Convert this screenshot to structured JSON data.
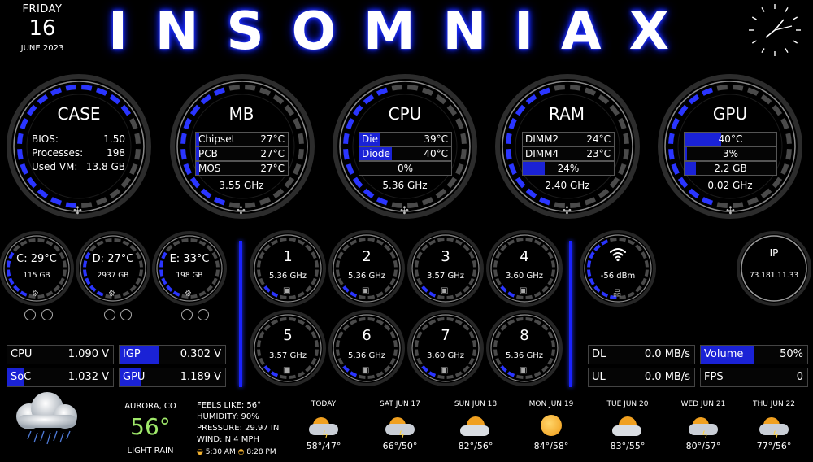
{
  "date": {
    "weekday": "FRIDAY",
    "day": "16",
    "month_year": "JUNE 2023"
  },
  "title": "INSOMNIAX",
  "colors": {
    "accent": "#1a22d6",
    "glow": "#2233ff",
    "temp_green": "#9fe86a"
  },
  "case": {
    "title": "CASE",
    "rows": [
      {
        "label": "BIOS:",
        "value": "1.50"
      },
      {
        "label": "Processes:",
        "value": "198"
      },
      {
        "label": "Used VM:",
        "value": "13.8 GB"
      }
    ],
    "fan_icon": "fan-icon"
  },
  "mb": {
    "title": "MB",
    "rows": [
      {
        "label": "Chipset",
        "value": "27°C"
      },
      {
        "label": "PCB",
        "value": "27°C"
      },
      {
        "label": "MOS",
        "value": "27°C"
      }
    ],
    "freq": "3.55 GHz"
  },
  "cpu": {
    "title": "CPU",
    "rows": [
      {
        "label": "Die",
        "value": "39°C"
      },
      {
        "label": "Diode",
        "value": "40°C"
      }
    ],
    "load": "0%",
    "load_fraction": 0.0,
    "freq": "5.36 GHz"
  },
  "ram": {
    "title": "RAM",
    "rows": [
      {
        "label": "DIMM2",
        "value": "24°C"
      },
      {
        "label": "DIMM4",
        "value": "23°C"
      }
    ],
    "usage": "24%",
    "usage_fraction": 0.24,
    "freq": "2.40 GHz"
  },
  "gpu": {
    "title": "GPU",
    "temp": "40°C",
    "temp_fraction": 0.4,
    "load": "3%",
    "load_fraction": 0.03,
    "mem": "2.2 GB",
    "mem_fraction": 0.12,
    "freq": "0.02 GHz"
  },
  "drives": [
    {
      "label": "C:",
      "temp": "29°C",
      "size": "115 GB"
    },
    {
      "label": "D:",
      "temp": "27°C",
      "size": "2937 GB"
    },
    {
      "label": "E:",
      "temp": "33°C",
      "size": "198 GB"
    }
  ],
  "cores": [
    {
      "num": "1",
      "freq": "5.36 GHz"
    },
    {
      "num": "2",
      "freq": "5.36 GHz"
    },
    {
      "num": "3",
      "freq": "3.57 GHz"
    },
    {
      "num": "4",
      "freq": "3.60 GHz"
    },
    {
      "num": "5",
      "freq": "3.57 GHz"
    },
    {
      "num": "6",
      "freq": "5.36 GHz"
    },
    {
      "num": "7",
      "freq": "3.60 GHz"
    },
    {
      "num": "8",
      "freq": "5.36 GHz"
    }
  ],
  "wifi": {
    "signal": "-56 dBm",
    "icon": "wifi-icon"
  },
  "ip": {
    "label": "IP",
    "value": "73.181.11.33"
  },
  "voltages": [
    {
      "label": "CPU",
      "value": "1.090 V",
      "fraction": 0.0
    },
    {
      "label": "IGP",
      "value": "0.302 V",
      "fraction": 0.38
    },
    {
      "label": "SoC",
      "value": "1.032 V",
      "fraction": 0.16
    },
    {
      "label": "GPU",
      "value": "1.189 V",
      "fraction": 0.21
    }
  ],
  "network": [
    {
      "label": "DL",
      "value": "0.0 MB/s"
    },
    {
      "label": "UL",
      "value": "0.0 MB/s"
    }
  ],
  "volume": {
    "label": "Volume",
    "value": "50%",
    "fraction": 0.5
  },
  "fps": {
    "label": "FPS",
    "value": "0"
  },
  "weather": {
    "location": "AURORA, CO",
    "temp": "56°",
    "condition": "LIGHT RAIN",
    "feels_like": "FEELS LIKE: 56°",
    "humidity": "HUMIDITY: 90%",
    "pressure": "PRESSURE: 29.97 IN",
    "wind": "WIND: N 4 MPH",
    "sunrise": "5:30 AM",
    "sunset": "8:28 PM"
  },
  "forecast": [
    {
      "day": "TODAY",
      "temps": "58°/47°",
      "icon": "storm-icon"
    },
    {
      "day": "SAT JUN 17",
      "temps": "66°/50°",
      "icon": "storm-icon"
    },
    {
      "day": "SUN JUN 18",
      "temps": "82°/56°",
      "icon": "partly-cloudy-icon"
    },
    {
      "day": "MON JUN 19",
      "temps": "84°/58°",
      "icon": "sun-icon"
    },
    {
      "day": "TUE JUN 20",
      "temps": "83°/55°",
      "icon": "partly-cloudy-icon"
    },
    {
      "day": "WED JUN 21",
      "temps": "80°/57°",
      "icon": "storm-icon"
    },
    {
      "day": "THU JUN 22",
      "temps": "77°/56°",
      "icon": "storm-icon"
    }
  ]
}
